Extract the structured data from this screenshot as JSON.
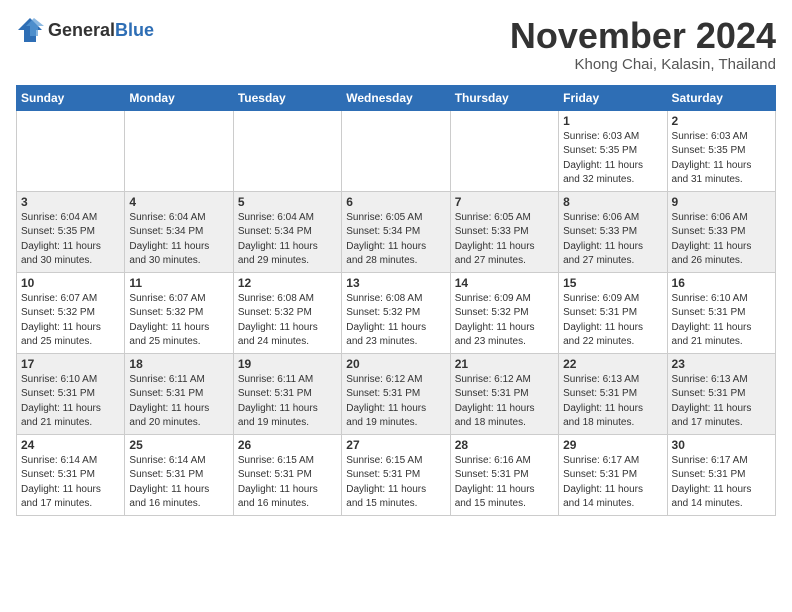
{
  "header": {
    "logo_general": "General",
    "logo_blue": "Blue",
    "month_title": "November 2024",
    "location": "Khong Chai, Kalasin, Thailand"
  },
  "days_of_week": [
    "Sunday",
    "Monday",
    "Tuesday",
    "Wednesday",
    "Thursday",
    "Friday",
    "Saturday"
  ],
  "weeks": [
    [
      {
        "date": "",
        "info": ""
      },
      {
        "date": "",
        "info": ""
      },
      {
        "date": "",
        "info": ""
      },
      {
        "date": "",
        "info": ""
      },
      {
        "date": "",
        "info": ""
      },
      {
        "date": "1",
        "info": "Sunrise: 6:03 AM\nSunset: 5:35 PM\nDaylight: 11 hours\nand 32 minutes."
      },
      {
        "date": "2",
        "info": "Sunrise: 6:03 AM\nSunset: 5:35 PM\nDaylight: 11 hours\nand 31 minutes."
      }
    ],
    [
      {
        "date": "3",
        "info": "Sunrise: 6:04 AM\nSunset: 5:35 PM\nDaylight: 11 hours\nand 30 minutes."
      },
      {
        "date": "4",
        "info": "Sunrise: 6:04 AM\nSunset: 5:34 PM\nDaylight: 11 hours\nand 30 minutes."
      },
      {
        "date": "5",
        "info": "Sunrise: 6:04 AM\nSunset: 5:34 PM\nDaylight: 11 hours\nand 29 minutes."
      },
      {
        "date": "6",
        "info": "Sunrise: 6:05 AM\nSunset: 5:34 PM\nDaylight: 11 hours\nand 28 minutes."
      },
      {
        "date": "7",
        "info": "Sunrise: 6:05 AM\nSunset: 5:33 PM\nDaylight: 11 hours\nand 27 minutes."
      },
      {
        "date": "8",
        "info": "Sunrise: 6:06 AM\nSunset: 5:33 PM\nDaylight: 11 hours\nand 27 minutes."
      },
      {
        "date": "9",
        "info": "Sunrise: 6:06 AM\nSunset: 5:33 PM\nDaylight: 11 hours\nand 26 minutes."
      }
    ],
    [
      {
        "date": "10",
        "info": "Sunrise: 6:07 AM\nSunset: 5:32 PM\nDaylight: 11 hours\nand 25 minutes."
      },
      {
        "date": "11",
        "info": "Sunrise: 6:07 AM\nSunset: 5:32 PM\nDaylight: 11 hours\nand 25 minutes."
      },
      {
        "date": "12",
        "info": "Sunrise: 6:08 AM\nSunset: 5:32 PM\nDaylight: 11 hours\nand 24 minutes."
      },
      {
        "date": "13",
        "info": "Sunrise: 6:08 AM\nSunset: 5:32 PM\nDaylight: 11 hours\nand 23 minutes."
      },
      {
        "date": "14",
        "info": "Sunrise: 6:09 AM\nSunset: 5:32 PM\nDaylight: 11 hours\nand 23 minutes."
      },
      {
        "date": "15",
        "info": "Sunrise: 6:09 AM\nSunset: 5:31 PM\nDaylight: 11 hours\nand 22 minutes."
      },
      {
        "date": "16",
        "info": "Sunrise: 6:10 AM\nSunset: 5:31 PM\nDaylight: 11 hours\nand 21 minutes."
      }
    ],
    [
      {
        "date": "17",
        "info": "Sunrise: 6:10 AM\nSunset: 5:31 PM\nDaylight: 11 hours\nand 21 minutes."
      },
      {
        "date": "18",
        "info": "Sunrise: 6:11 AM\nSunset: 5:31 PM\nDaylight: 11 hours\nand 20 minutes."
      },
      {
        "date": "19",
        "info": "Sunrise: 6:11 AM\nSunset: 5:31 PM\nDaylight: 11 hours\nand 19 minutes."
      },
      {
        "date": "20",
        "info": "Sunrise: 6:12 AM\nSunset: 5:31 PM\nDaylight: 11 hours\nand 19 minutes."
      },
      {
        "date": "21",
        "info": "Sunrise: 6:12 AM\nSunset: 5:31 PM\nDaylight: 11 hours\nand 18 minutes."
      },
      {
        "date": "22",
        "info": "Sunrise: 6:13 AM\nSunset: 5:31 PM\nDaylight: 11 hours\nand 18 minutes."
      },
      {
        "date": "23",
        "info": "Sunrise: 6:13 AM\nSunset: 5:31 PM\nDaylight: 11 hours\nand 17 minutes."
      }
    ],
    [
      {
        "date": "24",
        "info": "Sunrise: 6:14 AM\nSunset: 5:31 PM\nDaylight: 11 hours\nand 17 minutes."
      },
      {
        "date": "25",
        "info": "Sunrise: 6:14 AM\nSunset: 5:31 PM\nDaylight: 11 hours\nand 16 minutes."
      },
      {
        "date": "26",
        "info": "Sunrise: 6:15 AM\nSunset: 5:31 PM\nDaylight: 11 hours\nand 16 minutes."
      },
      {
        "date": "27",
        "info": "Sunrise: 6:15 AM\nSunset: 5:31 PM\nDaylight: 11 hours\nand 15 minutes."
      },
      {
        "date": "28",
        "info": "Sunrise: 6:16 AM\nSunset: 5:31 PM\nDaylight: 11 hours\nand 15 minutes."
      },
      {
        "date": "29",
        "info": "Sunrise: 6:17 AM\nSunset: 5:31 PM\nDaylight: 11 hours\nand 14 minutes."
      },
      {
        "date": "30",
        "info": "Sunrise: 6:17 AM\nSunset: 5:31 PM\nDaylight: 11 hours\nand 14 minutes."
      }
    ]
  ]
}
